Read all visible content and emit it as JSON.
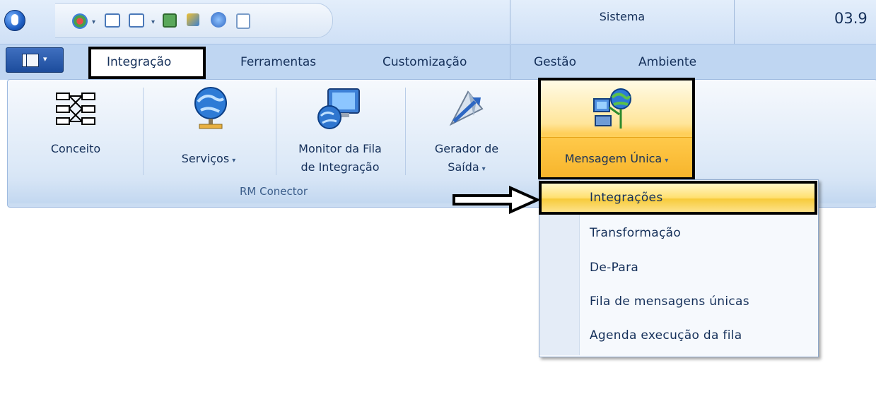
{
  "titlebar": {
    "system_label": "Sistema",
    "version": "03.9"
  },
  "tabs": [
    "Integração",
    "Ferramentas",
    "Customização",
    "Gestão",
    "Ambiente"
  ],
  "ribbon": {
    "group_label": "RM Conector",
    "buttons": {
      "conceito": "Conceito",
      "servicos": "Serviços",
      "monitor_line1": "Monitor da Fila",
      "monitor_line2": "de Integração",
      "gerador_line1": "Gerador de",
      "gerador_line2": "Saída",
      "mensagem_unica": "Mensagem Única"
    },
    "dropdown_glyph": "▾"
  },
  "menu": {
    "items": [
      "Integrações",
      "Transformação",
      "De-Para",
      "Fila de mensagens únicas",
      "Agenda execução da fila"
    ]
  },
  "colors": {
    "highlight": "#ffd96c",
    "ribbon_bg": "#dbe8f7",
    "tab_bar": "#bfd6f2"
  }
}
